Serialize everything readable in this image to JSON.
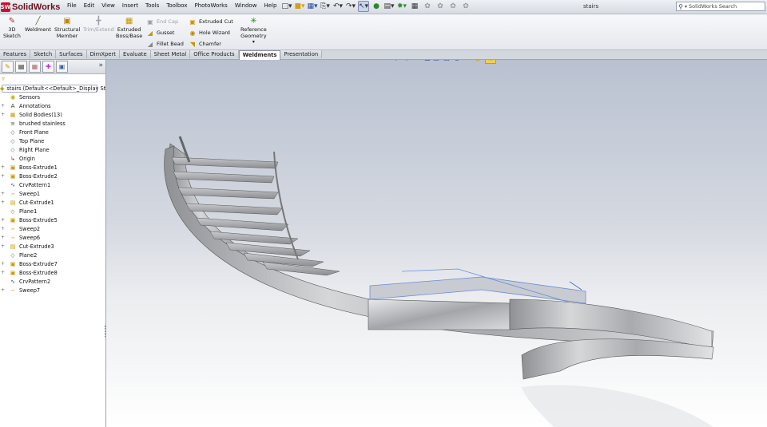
{
  "app": {
    "name": "SolidWorks",
    "logo_mark": "SW"
  },
  "menu": [
    "File",
    "Edit",
    "View",
    "Insert",
    "Tools",
    "Toolbox",
    "PhotoWorks",
    "Window",
    "Help"
  ],
  "quick_access_icons": [
    "pin-icon",
    "new-document-icon",
    "open-icon",
    "save-icon",
    "print-icon",
    "undo-icon",
    "redo-icon",
    "select-icon",
    "rebuild-icon",
    "file-properties-icon",
    "options-icon",
    "grid-icon",
    "view-icon-1",
    "view-icon-2",
    "view-icon-3",
    "view-icon-4"
  ],
  "document_title": "stairs",
  "search": {
    "placeholder": "SolidWorks Search"
  },
  "ribbon": {
    "sketch_3d": {
      "line1": "3D",
      "line2": "Sketch"
    },
    "weldment": {
      "line1": "Weldment",
      "line2": ""
    },
    "structural_member": {
      "line1": "Structural",
      "line2": "Member"
    },
    "trim_extend": {
      "line1": "Trim/Extend",
      "line2": ""
    },
    "extruded_boss": {
      "line1": "Extruded",
      "line2": "Boss/Base"
    },
    "end_cap": "End Cap",
    "gusset": "Gusset",
    "fillet_bead": "Fillet Bead",
    "extruded_cut": "Extruded Cut",
    "hole_wizard": "Hole Wizard",
    "chamfer": "Chamfer",
    "reference_geometry": {
      "line1": "Reference",
      "line2": "Geometry"
    }
  },
  "tabs": [
    "Features",
    "Sketch",
    "Surfaces",
    "DimXpert",
    "Evaluate",
    "Sheet Metal",
    "Office Products",
    "Weldments",
    "Presentation"
  ],
  "active_tab": "Weldments",
  "tree": [
    {
      "label": "stairs  (Default<<Default>_Display Stat",
      "icon": "part-icon",
      "expand": "",
      "indent": 0
    },
    {
      "label": "Sensors",
      "icon": "sensor-icon",
      "expand": "",
      "indent": 1
    },
    {
      "label": "Annotations",
      "icon": "annotation-icon",
      "expand": "+",
      "indent": 1
    },
    {
      "label": "Solid Bodies(13)",
      "icon": "solid-bodies-icon",
      "expand": "+",
      "indent": 1
    },
    {
      "label": "brushed stainless",
      "icon": "material-icon",
      "expand": "",
      "indent": 1
    },
    {
      "label": "Front Plane",
      "icon": "plane-icon",
      "expand": "",
      "indent": 1
    },
    {
      "label": "Top Plane",
      "icon": "plane-icon",
      "expand": "",
      "indent": 1
    },
    {
      "label": "Right Plane",
      "icon": "plane-icon",
      "expand": "",
      "indent": 1
    },
    {
      "label": "Origin",
      "icon": "origin-icon",
      "expand": "",
      "indent": 1
    },
    {
      "label": "Boss-Extrude1",
      "icon": "extrude-icon",
      "expand": "+",
      "indent": 1
    },
    {
      "label": "Boss-Extrude2",
      "icon": "extrude-icon",
      "expand": "+",
      "indent": 1
    },
    {
      "label": "CrvPattern1",
      "icon": "curve-pattern-icon",
      "expand": "",
      "indent": 1
    },
    {
      "label": "Sweep1",
      "icon": "sweep-icon",
      "expand": "+",
      "indent": 1
    },
    {
      "label": "Cut-Extrude1",
      "icon": "cut-extrude-icon",
      "expand": "+",
      "indent": 1
    },
    {
      "label": "Plane1",
      "icon": "plane-icon",
      "expand": "",
      "indent": 1
    },
    {
      "label": "Boss-Extrude5",
      "icon": "extrude-icon",
      "expand": "+",
      "indent": 1
    },
    {
      "label": "Sweep2",
      "icon": "sweep-icon",
      "expand": "+",
      "indent": 1
    },
    {
      "label": "Sweep6",
      "icon": "sweep-icon",
      "expand": "+",
      "indent": 1
    },
    {
      "label": "Cut-Extrude3",
      "icon": "cut-extrude-icon",
      "expand": "+",
      "indent": 1
    },
    {
      "label": "Plane2",
      "icon": "plane-icon",
      "expand": "",
      "indent": 1
    },
    {
      "label": "Boss-Extrude7",
      "icon": "extrude-icon",
      "expand": "+",
      "indent": 1
    },
    {
      "label": "Boss-Extrude8",
      "icon": "extrude-icon",
      "expand": "+",
      "indent": 1
    },
    {
      "label": "CrvPattern2",
      "icon": "curve-pattern-icon",
      "expand": "",
      "indent": 1
    },
    {
      "label": "Sweep7",
      "icon": "sweep-icon",
      "expand": "+",
      "indent": 1
    }
  ],
  "view_toolbar_icons": [
    "zoom-to-fit-icon",
    "zoom-to-area-icon",
    "previous-view-icon",
    "section-view-icon",
    "view-orientation-icon",
    "display-style-icon",
    "hide-show-icon",
    "edit-appearance-icon",
    "apply-scene-icon",
    "view-settings-icon"
  ]
}
